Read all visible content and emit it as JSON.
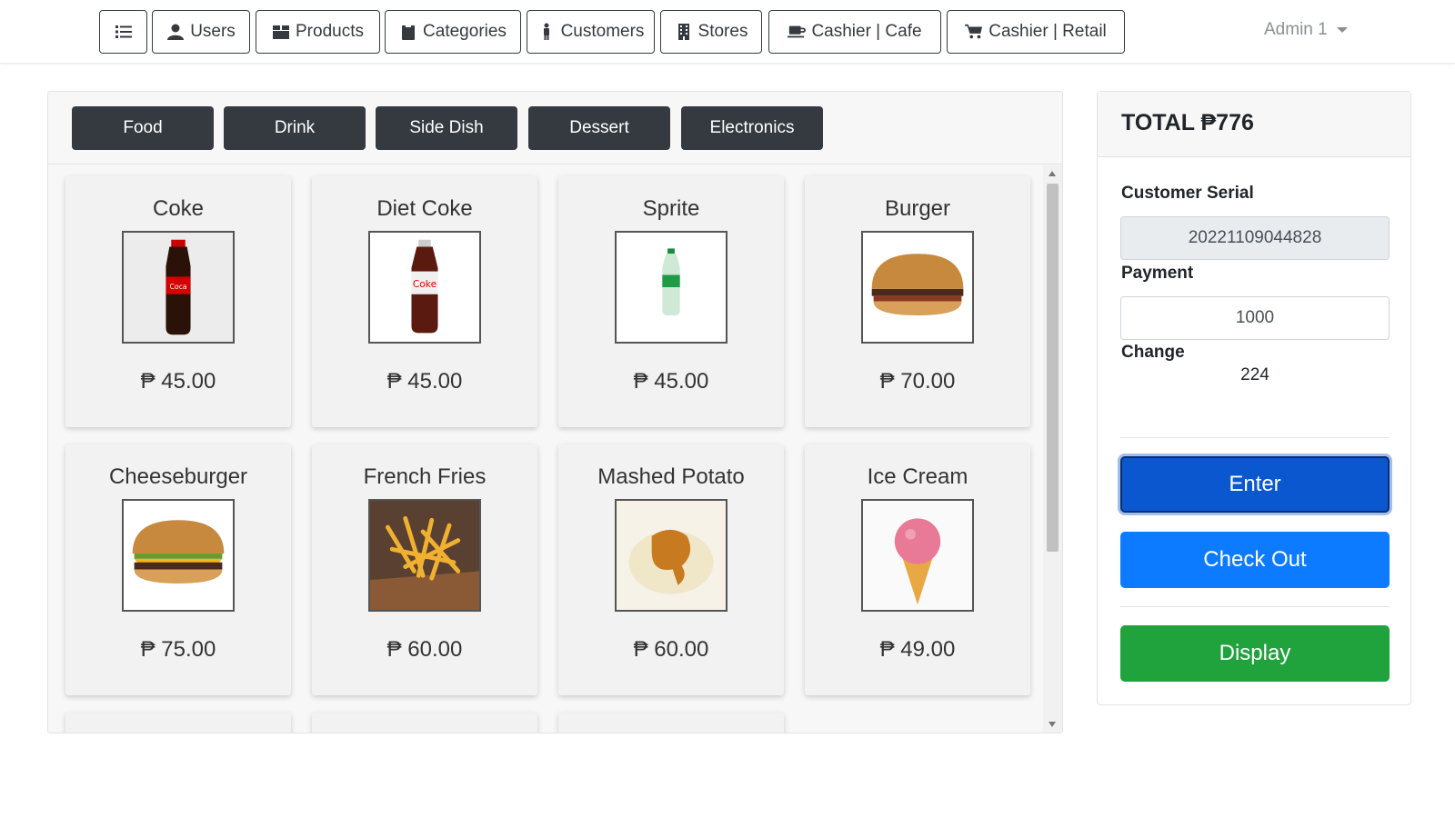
{
  "nav": {
    "items": [
      {
        "label": "",
        "icon": "list-icon"
      },
      {
        "label": "Users",
        "icon": "user-icon"
      },
      {
        "label": "Products",
        "icon": "box-icon"
      },
      {
        "label": "Categories",
        "icon": "clipboard-icon"
      },
      {
        "label": "Customers",
        "icon": "person-icon"
      },
      {
        "label": "Stores",
        "icon": "building-icon"
      },
      {
        "label": "Cashier | Cafe",
        "icon": "cup-icon"
      },
      {
        "label": "Cashier | Retail",
        "icon": "cart-icon"
      }
    ],
    "admin_label": "Admin 1"
  },
  "categories": [
    "Food",
    "Drink",
    "Side Dish",
    "Dessert",
    "Electronics"
  ],
  "products": [
    {
      "name": "Coke",
      "price": "₱ 45.00",
      "image": "coke-bottle"
    },
    {
      "name": "Diet Coke",
      "price": "₱ 45.00",
      "image": "diet-coke-bottle"
    },
    {
      "name": "Sprite",
      "price": "₱ 45.00",
      "image": "sprite-bottle"
    },
    {
      "name": "Burger",
      "price": "₱ 70.00",
      "image": "burger"
    },
    {
      "name": "Cheeseburger",
      "price": "₱ 75.00",
      "image": "cheeseburger"
    },
    {
      "name": "French Fries",
      "price": "₱ 60.00",
      "image": "french-fries"
    },
    {
      "name": "Mashed Potato",
      "price": "₱ 60.00",
      "image": "mashed-potato"
    },
    {
      "name": "Ice Cream",
      "price": "₱ 49.00",
      "image": "ice-cream"
    }
  ],
  "checkout": {
    "total_label": "TOTAL ₱776",
    "customer_serial_label": "Customer Serial",
    "customer_serial_value": "20221109044828",
    "payment_label": "Payment",
    "payment_value": "1000",
    "change_label": "Change",
    "change_value": "224",
    "enter_label": "Enter",
    "checkout_label": "Check Out",
    "display_label": "Display"
  },
  "colors": {
    "dark": "#343a40",
    "primary": "#0d7bff",
    "enter": "#0a57d0",
    "success": "#20a23d"
  }
}
